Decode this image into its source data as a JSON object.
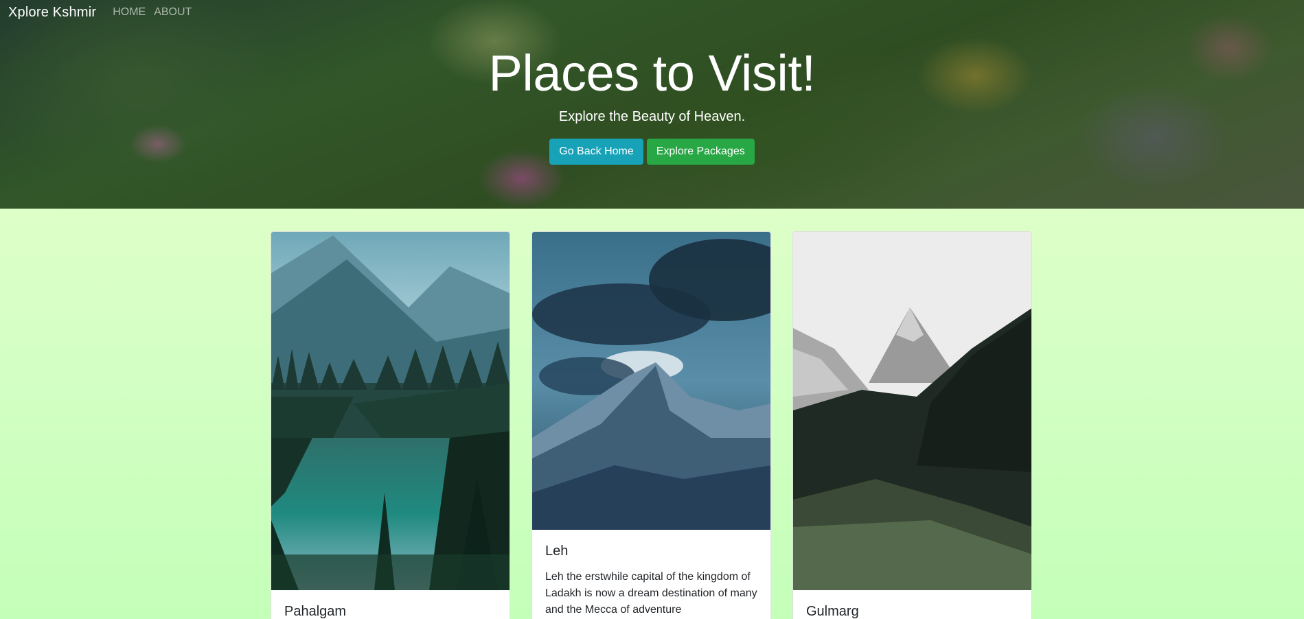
{
  "navbar": {
    "brand": "Xplore Kshmir",
    "links": [
      {
        "label": "HOME"
      },
      {
        "label": "ABOUT"
      }
    ]
  },
  "hero": {
    "title": "Places to Visit!",
    "subtitle": "Explore the Beauty of Heaven.",
    "buttons": [
      {
        "label": "Go Back Home",
        "color": "#17a2b8"
      },
      {
        "label": "Explore Packages",
        "color": "#28a745"
      }
    ]
  },
  "cards": [
    {
      "title": "Pahalgam",
      "text": "",
      "image": "lake-forest-mountains-photo"
    },
    {
      "title": "Leh",
      "text": "Leh the erstwhile capital of the kingdom of Ladakh is now a dream destination of many and the Mecca of adventure",
      "image": "cloudy-snow-mountain-photo"
    },
    {
      "title": "Gulmarg",
      "text": "",
      "image": "snow-peak-pine-forest-photo"
    }
  ],
  "colors": {
    "page_bg_top": "#ebffcd",
    "page_bg_bottom": "#c4ffb8",
    "text": "#212529"
  }
}
